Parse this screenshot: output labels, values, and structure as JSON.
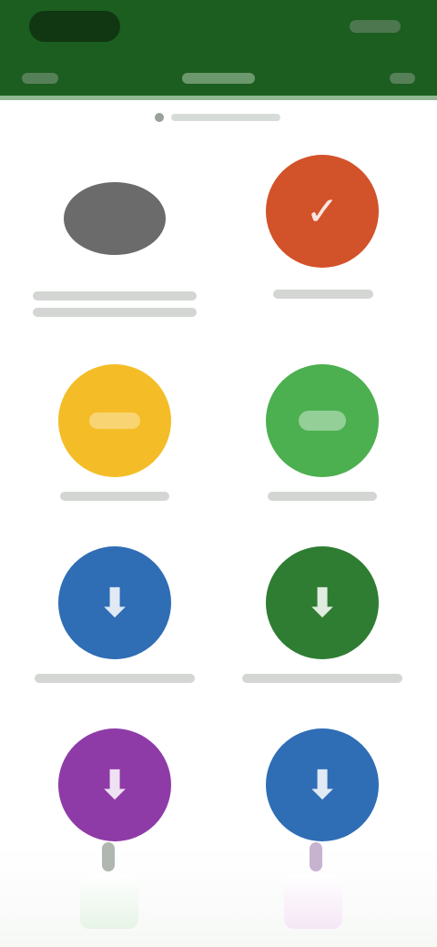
{
  "status_bar": {
    "clock": "",
    "icons": [
      "wifi-icon",
      "battery-icon"
    ]
  },
  "tabs": [
    {
      "label": ""
    },
    {
      "label": ""
    },
    {
      "label": ""
    }
  ],
  "colors": {
    "app_bar": "#1b5e20",
    "tile_gray": "#6b6b6b",
    "tile_orange": "#d2522a",
    "tile_yellow": "#f4bd27",
    "tile_light_green": "#4caf50",
    "tile_blue_1": "#2f6db5",
    "tile_green_2": "#2e7d32",
    "tile_purple": "#8e3ba8",
    "tile_blue_2": "#2f6db5"
  },
  "tiles": [
    {
      "label": "",
      "icon": "gray-oval-icon"
    },
    {
      "label": "",
      "icon": "check-icon"
    },
    {
      "label": "",
      "icon": "yellow-icon"
    },
    {
      "label": "",
      "icon": "green-chat-icon"
    },
    {
      "label": "",
      "icon": "download-arrow-icon"
    },
    {
      "label": "",
      "icon": "download-arrow-icon"
    },
    {
      "label": "",
      "icon": "download-arrow-icon"
    },
    {
      "label": "",
      "icon": "download-arrow-icon"
    }
  ]
}
